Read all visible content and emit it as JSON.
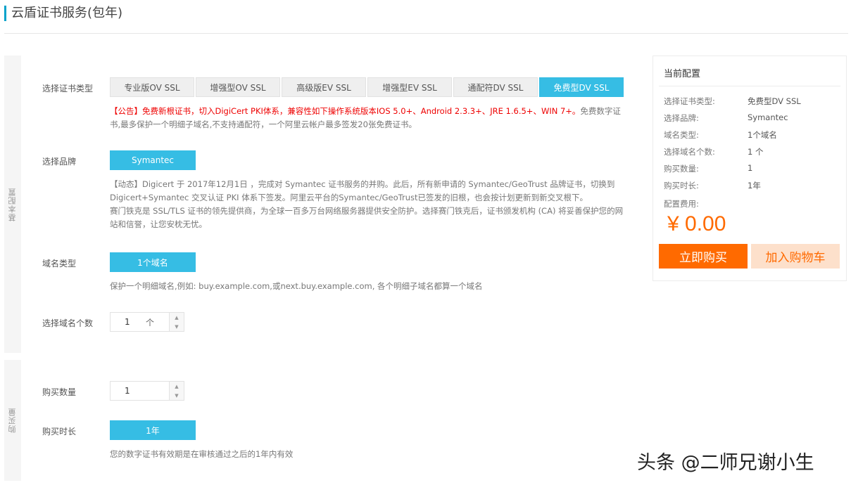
{
  "page": {
    "title": "云盾证书服务(包年)"
  },
  "basic_section": {
    "label": "基本配置",
    "cert_type": {
      "label": "选择证书类型",
      "options": [
        "专业版OV SSL",
        "增强型OV SSL",
        "高级版EV SSL",
        "增强型EV SSL",
        "通配符DV SSL",
        "免费型DV SSL"
      ],
      "selected": "免费型DV SSL",
      "notice_red": "【公告】免费新根证书，切入DigiCert PKI体系，兼容性如下操作系统版本IOS 5.0+、Android 2.3.3+、JRE 1.6.5+、WIN 7+。",
      "notice_gray": "免费数字证书,最多保护一个明细子域名,不支持通配符，一个阿里云帐户最多签发20张免费证书。"
    },
    "brand": {
      "label": "选择品牌",
      "selected": "Symantec",
      "desc_1": "【动态】Digicert 于 2017年12月1日 ，完成对 Symantec 证书服务的并购。此后，所有新申请的 Symantec/GeoTrust 品牌证书，切换到 Digicert+Symantec 交叉认证 PKI 体系下签发。阿里云平台的Symantec/GeoTrust已签发的旧根，也会按计划更新到新交叉根下。",
      "desc_2": "赛门铁克是 SSL/TLS 证书的领先提供商，为全球一百多万台网络服务器提供安全防护。选择赛门铁克后，证书颁发机构 (CA) 将妥善保护您的网站和信誉，让您安枕无忧。"
    },
    "domain_type": {
      "label": "域名类型",
      "selected": "1个域名",
      "desc": "保护一个明细域名,例如: buy.example.com,或next.buy.example.com, 各个明细子域名都算一个域名"
    },
    "domain_count": {
      "label": "选择域名个数",
      "value": "1",
      "unit": "个"
    }
  },
  "purchase_section": {
    "label": "购买量",
    "quantity": {
      "label": "购买数量",
      "value": "1"
    },
    "duration": {
      "label": "购买时长",
      "selected": "1年",
      "desc": "您的数字证书有效期是在审核通过之后的1年内有效"
    }
  },
  "summary": {
    "title": "当前配置",
    "rows": [
      {
        "key": "选择证书类型:",
        "value": "免费型DV SSL"
      },
      {
        "key": "选择品牌:",
        "value": "Symantec"
      },
      {
        "key": "域名类型:",
        "value": "1个域名"
      },
      {
        "key": "选择域名个数:",
        "value": "1 个"
      },
      {
        "key": "购买数量:",
        "value": "1"
      },
      {
        "key": "购买时长:",
        "value": "1年"
      }
    ],
    "fee_label": "配置费用:",
    "price": "¥ 0.00",
    "buy_label": "立即购买",
    "cart_label": "加入购物车"
  },
  "watermark": "头条 @二师兄谢小生",
  "colors": {
    "accent": "#36bde4",
    "buy": "#ff6a00",
    "cart_bg": "#fde0cb",
    "notice_red": "#e00000"
  }
}
